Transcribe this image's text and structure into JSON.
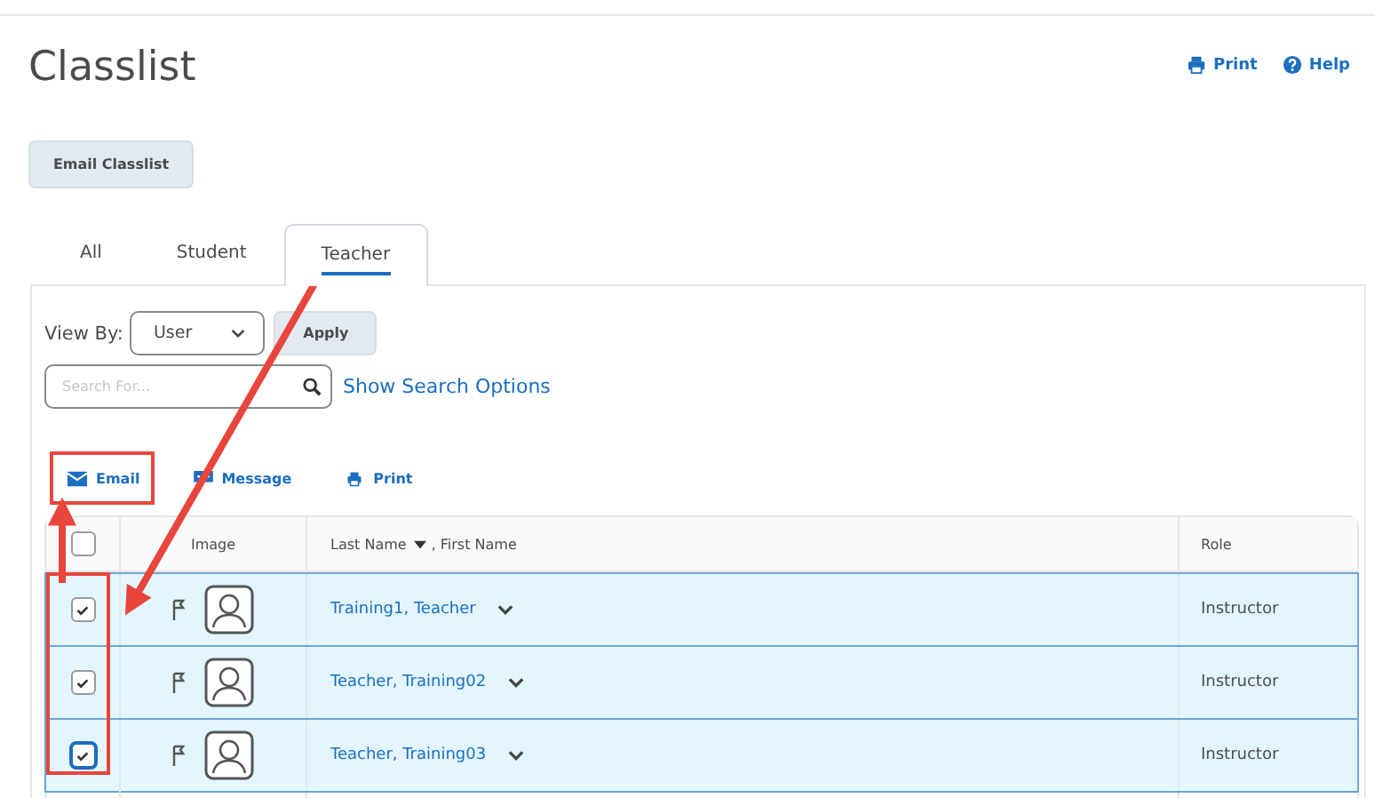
{
  "title": "Classlist",
  "header_links": [
    {
      "kind": "print",
      "label": "Print"
    },
    {
      "kind": "help",
      "label": "Help"
    }
  ],
  "email_classlist_button": "Email Classlist",
  "tabs": [
    {
      "label": "All",
      "selected": false
    },
    {
      "label": "Student",
      "selected": false
    },
    {
      "label": "Teacher",
      "selected": true
    }
  ],
  "view_by": {
    "label": "View By:",
    "value": "User"
  },
  "apply_button": "Apply",
  "search": {
    "placeholder": "Search For..."
  },
  "show_search_options": "Show Search Options",
  "actions": [
    {
      "kind": "email",
      "label": "Email",
      "highlighted": true
    },
    {
      "kind": "message",
      "label": "Message",
      "highlighted": false
    },
    {
      "kind": "print",
      "label": "Print",
      "highlighted": false
    }
  ],
  "table": {
    "header_checked": false,
    "columns": [
      "Image",
      "Last Name",
      ", First Name",
      "Role"
    ],
    "rows": [
      {
        "name": "Training1, Teacher",
        "role": "Instructor",
        "checked": true,
        "selected": true,
        "focused": false
      },
      {
        "name": "Teacher, Training02",
        "role": "Instructor",
        "checked": true,
        "selected": true,
        "focused": false
      },
      {
        "name": "Teacher, Training03",
        "role": "Instructor",
        "checked": true,
        "selected": true,
        "focused": true
      }
    ]
  }
}
